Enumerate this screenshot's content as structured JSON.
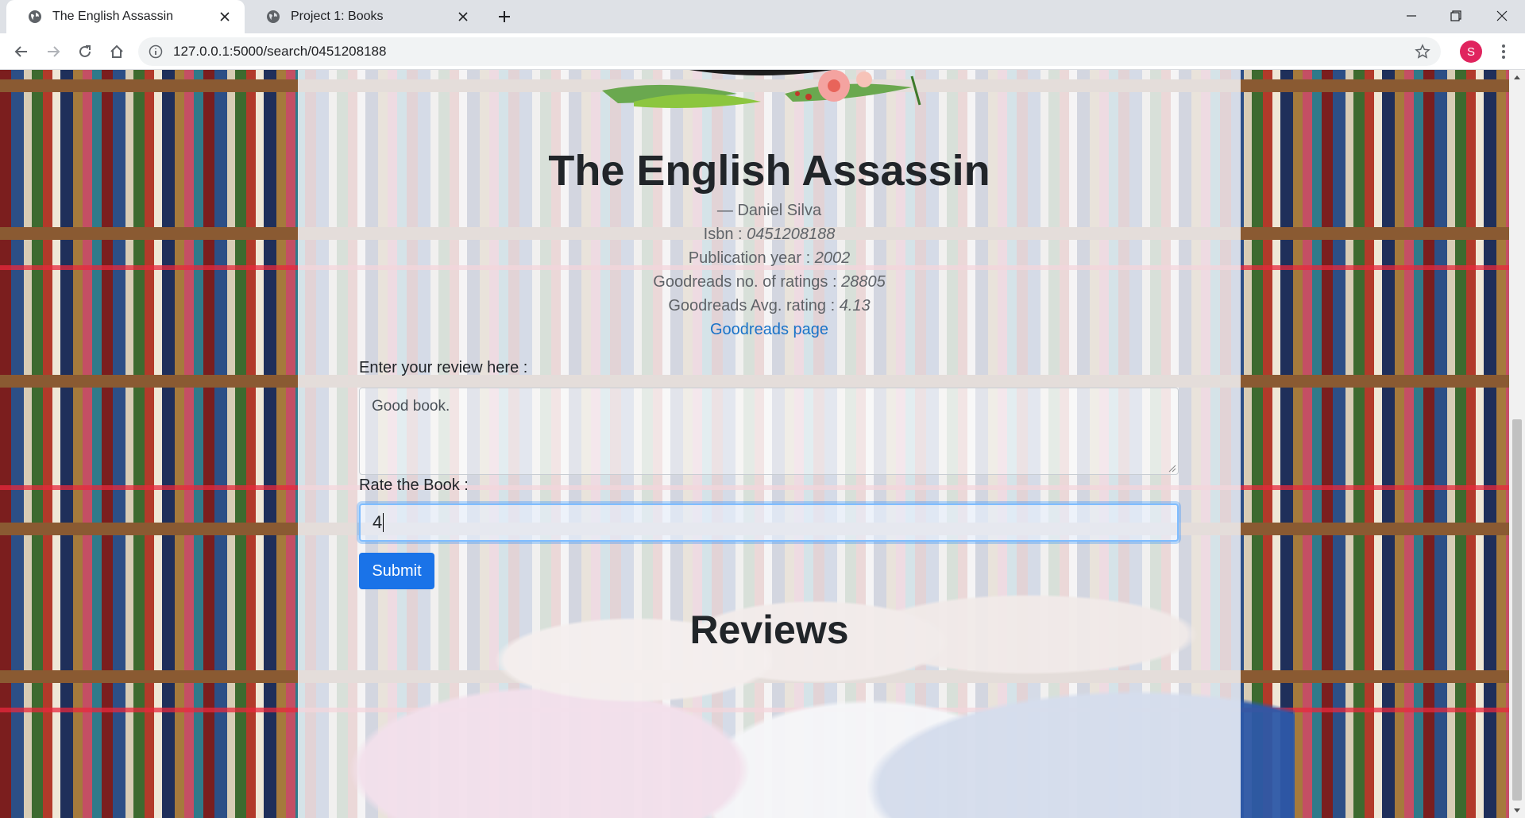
{
  "browser": {
    "tabs": [
      {
        "title": "The English Assassin",
        "active": true
      },
      {
        "title": "Project 1: Books",
        "active": false
      }
    ],
    "url": "127.0.0.1:5000/search/0451208188",
    "profile_initial": "S",
    "colors": {
      "avatar": "#e0245e",
      "tab_active": "#ffffff",
      "tabbar": "#dee1e6"
    }
  },
  "book": {
    "title": "The English Assassin",
    "author": "— Daniel Silva",
    "isbn_label": "Isbn :",
    "isbn": "0451208188",
    "year_label": "Publication year :",
    "year": "2002",
    "ratings_count_label": "Goodreads no. of ratings :",
    "ratings_count": "28805",
    "avg_rating_label": "Goodreads Avg. rating :",
    "avg_rating": "4.13",
    "goodreads_link": "Goodreads page"
  },
  "form": {
    "review_label": "Enter your review here :",
    "review_value": "Good book.",
    "rate_label": "Rate the Book :",
    "rate_value": "4",
    "submit_label": "Submit"
  },
  "reviews": {
    "heading": "Reviews"
  },
  "colors": {
    "primary_button": "#1a73e8",
    "link": "#1a73c8",
    "focus_ring": "#80bdff"
  }
}
